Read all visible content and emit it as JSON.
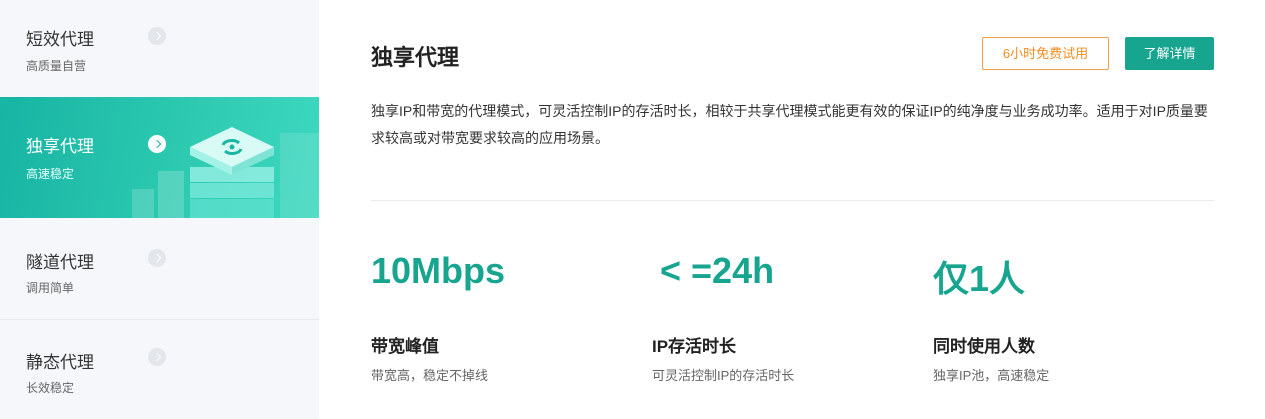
{
  "sidebar": {
    "items": [
      {
        "title": "短效代理",
        "sub": "高质量自营"
      },
      {
        "title": "独享代理",
        "sub": "高速稳定"
      },
      {
        "title": "隧道代理",
        "sub": "调用简单"
      },
      {
        "title": "静态代理",
        "sub": "长效稳定"
      }
    ],
    "active_index": 1
  },
  "main": {
    "title": "独享代理",
    "trial_button": "6小时免费试用",
    "detail_button": "了解详情",
    "description": "独享IP和带宽的代理模式，可灵活控制IP的存活时长，相较于共享代理模式能更有效的保证IP的纯净度与业务成功率。适用于对IP质量要求较高或对带宽要求较高的应用场景。",
    "stats": [
      {
        "value": "10Mbps",
        "label": "带宽峰值",
        "sub": "带宽高，稳定不掉线"
      },
      {
        "value": "< =24h",
        "label": "IP存活时长",
        "sub": "可灵活控制IP的存活时长"
      },
      {
        "value": "仅1人",
        "label": "同时使用人数",
        "sub": "独享IP池，高速稳定"
      }
    ]
  },
  "colors": {
    "accent": "#17a58f",
    "trial_orange": "#f08c1e",
    "sidebar_bg": "#f5f7fa"
  },
  "icons": {
    "chevron": "chevron-right-icon",
    "illustration": "server-stack-icon"
  }
}
